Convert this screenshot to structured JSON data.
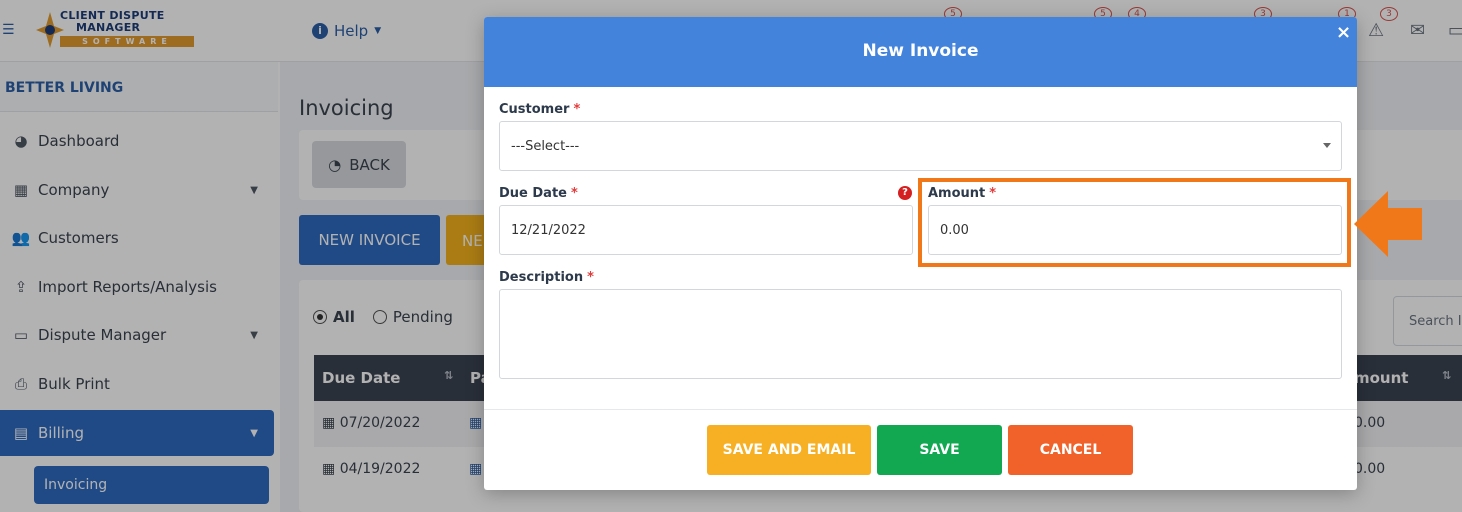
{
  "header": {
    "logo": {
      "line1": "CLIENT DISPUTE",
      "line2": "MANAGER",
      "line3": "SOFTWARE"
    },
    "help_label": "Help",
    "badges": [
      "5",
      "5",
      "4",
      "3",
      "1",
      "3"
    ]
  },
  "sidebar": {
    "org_name": "BETTER LIVING",
    "items": [
      {
        "label": "Dashboard",
        "icon": "pie-chart-icon"
      },
      {
        "label": "Company",
        "icon": "building-icon"
      },
      {
        "label": "Customers",
        "icon": "users-icon"
      },
      {
        "label": "Import Reports/Analysis",
        "icon": "file-upload-icon"
      },
      {
        "label": "Dispute Manager",
        "icon": "laptop-icon"
      },
      {
        "label": "Bulk Print",
        "icon": "print-icon"
      },
      {
        "label": "Billing",
        "icon": "invoice-icon"
      }
    ],
    "sub_item": "Invoicing"
  },
  "main": {
    "title": "Invoicing",
    "back_label": "BACK",
    "new_invoice_label": "NEW INVOICE",
    "second_button_partial": "NE",
    "filters": [
      "All",
      "Pending"
    ],
    "search_placeholder": "Search I",
    "columns": [
      "Due Date",
      "Pa",
      "mount"
    ],
    "rows": [
      {
        "due_date": "07/20/2022",
        "amount": "0.00"
      },
      {
        "due_date": "04/19/2022",
        "amount": "0.00"
      }
    ]
  },
  "modal": {
    "title": "New Invoice",
    "close": "×",
    "customer_label": "Customer",
    "customer_value": "---Select---",
    "due_date_label": "Due Date",
    "due_date_value": "12/21/2022",
    "amount_label": "Amount",
    "amount_value": "0.00",
    "description_label": "Description",
    "description_value": "",
    "required_mark": "*",
    "buttons": {
      "save_email": "SAVE AND EMAIL",
      "save": "SAVE",
      "cancel": "CANCEL"
    }
  },
  "colors": {
    "header_blue": "#4383dc",
    "save_email": "#f7b023",
    "save": "#12a852",
    "cancel": "#f0622a",
    "highlight": "#f07818"
  }
}
